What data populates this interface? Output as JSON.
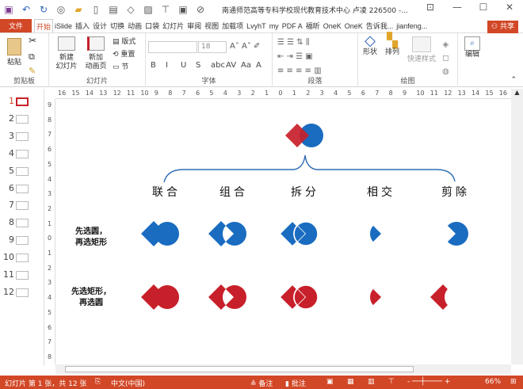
{
  "titlebar": {
    "title": "南通师范高等专科学校现代教育技术中心 卢凌 226500 -...",
    "quick_access": [
      "save-icon",
      "undo-icon",
      "redo-icon",
      "slideshow-icon",
      "open-icon",
      "new-icon",
      "layout-icon",
      "shape-icon",
      "picture-icon",
      "presenter-icon",
      "screenshot-icon",
      "more-icon"
    ]
  },
  "tabs": [
    "文件",
    "开始",
    "iSlide",
    "插入",
    "设计",
    "切换",
    "动画",
    "口袋",
    "幻灯片",
    "审阅",
    "视图",
    "加载项",
    "LvyhT",
    "my",
    "PDF A",
    "福昕",
    "OneK",
    "OneK",
    "告诉我...",
    "jianfeng..."
  ],
  "share": "共享",
  "ribbon": {
    "clipboard": {
      "label": "剪贴板",
      "paste": "粘贴"
    },
    "slides": {
      "label": "幻灯片",
      "new_slide": "新建\n幻灯片",
      "new_anim": "新加\n动画页",
      "layout": "版式",
      "reset": "重置",
      "section": "节"
    },
    "font": {
      "label": "字体",
      "font_size": "18",
      "buttons": [
        "B",
        "I",
        "U",
        "S",
        "abc",
        "AV",
        "Aa",
        "A"
      ]
    },
    "paragraph": {
      "label": "段落"
    },
    "drawing": {
      "label": "绘图",
      "shape": "形状",
      "arrange": "排列",
      "quick_styles": "快速样式"
    },
    "editing": {
      "label": "编辑"
    }
  },
  "thumbnails": [
    "1",
    "2",
    "3",
    "4",
    "5",
    "6",
    "7",
    "8",
    "9",
    "10",
    "11",
    "12"
  ],
  "current_slide": 1,
  "hruler": [
    "16",
    "15",
    "14",
    "13",
    "12",
    "11",
    "10",
    "9",
    "8",
    "7",
    "6",
    "5",
    "4",
    "3",
    "2",
    "1",
    "0",
    "1",
    "2",
    "3",
    "4",
    "5",
    "6",
    "7",
    "8",
    "9",
    "10",
    "11",
    "12",
    "13",
    "14",
    "15",
    "16"
  ],
  "vruler": [
    "9",
    "8",
    "7",
    "6",
    "5",
    "4",
    "3",
    "2",
    "1",
    "0",
    "1",
    "2",
    "3",
    "4",
    "5",
    "6",
    "7",
    "8"
  ],
  "slide": {
    "operations": [
      "联合",
      "组合",
      "拆分",
      "相交",
      "剪除"
    ],
    "row1_label": "先选圆，\n再选矩形",
    "row2_label": "先选矩形，\n再选圆",
    "colors": {
      "blue": "#1a6cc0",
      "red": "#c8202a"
    }
  },
  "status": {
    "slide_info": "幻灯片 第 1 张，共 12 张",
    "language": "中文(中国)",
    "notes": "备注",
    "comments": "批注",
    "zoom": "66%"
  }
}
